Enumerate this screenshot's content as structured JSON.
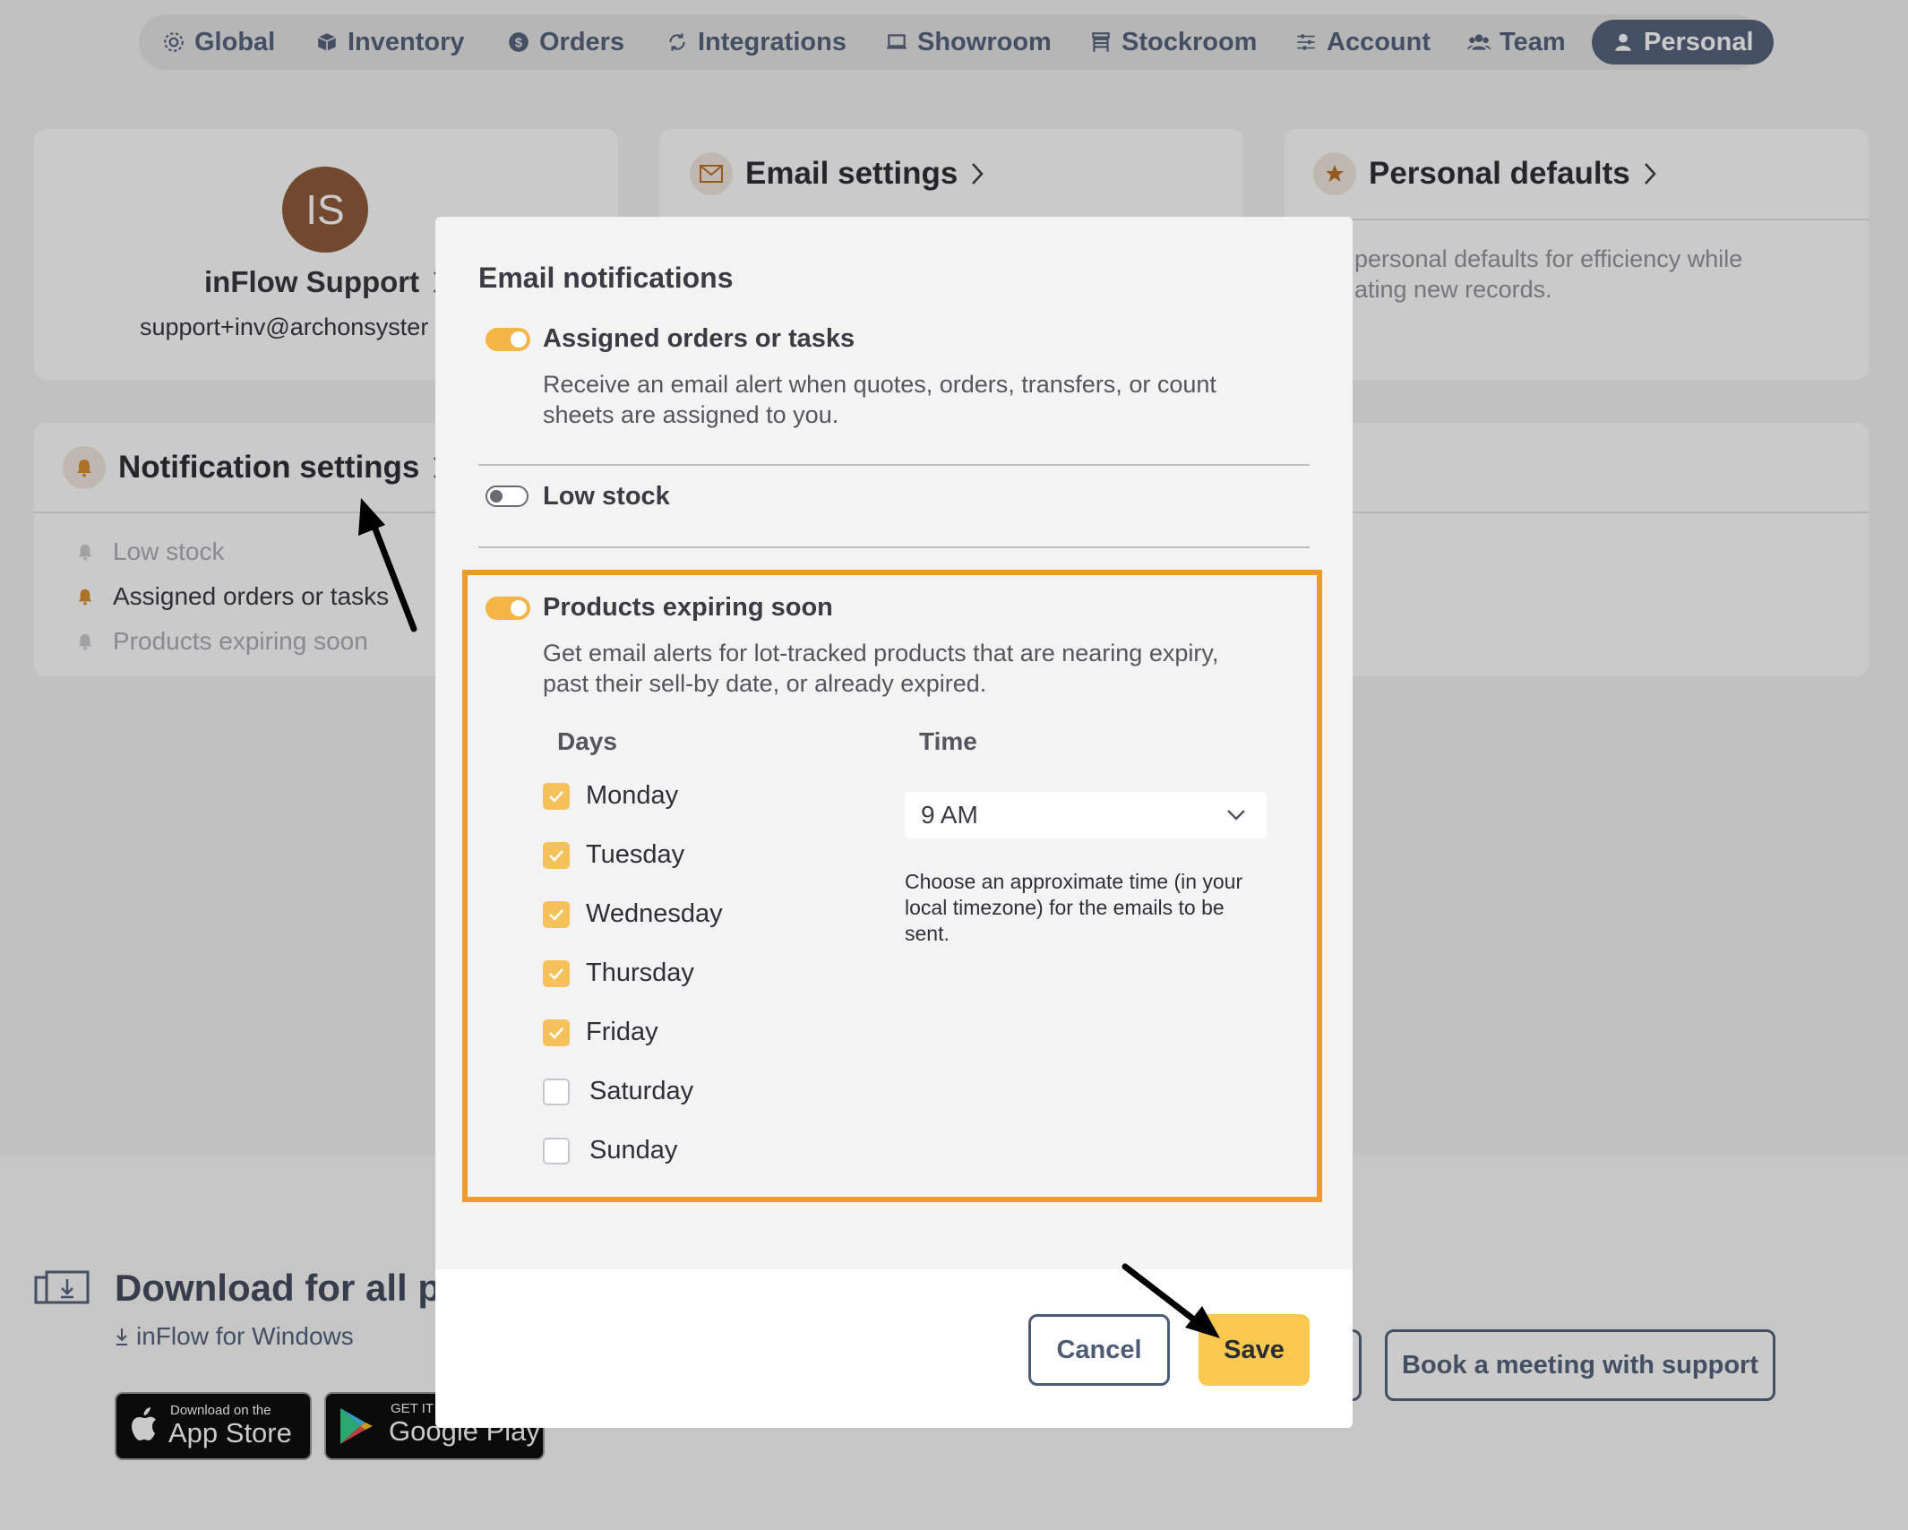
{
  "nav": {
    "items": [
      {
        "label": "Global",
        "icon": "gear-icon"
      },
      {
        "label": "Inventory",
        "icon": "box-icon"
      },
      {
        "label": "Orders",
        "icon": "dollar-icon"
      },
      {
        "label": "Integrations",
        "icon": "sync-icon"
      },
      {
        "label": "Showroom",
        "icon": "laptop-icon"
      },
      {
        "label": "Stockroom",
        "icon": "shelf-icon"
      },
      {
        "label": "Account",
        "icon": "sliders-icon"
      },
      {
        "label": "Team",
        "icon": "team-icon"
      },
      {
        "label": "Personal",
        "icon": "person-icon",
        "active": true
      }
    ]
  },
  "profile": {
    "initials": "IS",
    "name": "inFlow Support",
    "email": "support+inv@archonsyster"
  },
  "email_settings": {
    "title": "Email settings"
  },
  "personal_defaults": {
    "title": "Personal defaults",
    "desc_line1": "personal defaults for efficiency while",
    "desc_line2": "ating new records."
  },
  "notification_settings": {
    "title": "Notification settings",
    "items": [
      {
        "label": "Low stock",
        "active": false
      },
      {
        "label": "Assigned orders or tasks",
        "active": true
      },
      {
        "label": "Products expiring soon",
        "active": false
      }
    ]
  },
  "download": {
    "title": "Download for all pla",
    "windows_link": "inFlow for Windows",
    "app_store_small": "Download on the",
    "app_store_big": "App Store",
    "google_small": "GET IT O",
    "google_big": "Google Play"
  },
  "book_meeting": "Book a meeting with support",
  "modal": {
    "title": "Email notifications",
    "assigned": {
      "label": "Assigned orders or tasks",
      "enabled": true,
      "desc": "Receive an email alert when quotes, orders, transfers, or count sheets are assigned to you."
    },
    "low_stock": {
      "label": "Low stock",
      "enabled": false
    },
    "expiring": {
      "label": "Products expiring soon",
      "enabled": true,
      "desc": "Get email alerts for lot-tracked products that are nearing expiry, past their sell-by date, or already expired."
    },
    "days_header": "Days",
    "time_header": "Time",
    "days": [
      {
        "label": "Monday",
        "checked": true
      },
      {
        "label": "Tuesday",
        "checked": true
      },
      {
        "label": "Wednesday",
        "checked": true
      },
      {
        "label": "Thursday",
        "checked": true
      },
      {
        "label": "Friday",
        "checked": true
      },
      {
        "label": "Saturday",
        "checked": false
      },
      {
        "label": "Sunday",
        "checked": false
      }
    ],
    "time_value": "9 AM",
    "time_help": "Choose an approximate time (in your local timezone) for the emails to be sent.",
    "cancel": "Cancel",
    "save": "Save"
  },
  "colors": {
    "accent": "#f5b546",
    "highlight_border": "#ee9b2e",
    "nav_active": "#4e5b76",
    "save_bg": "#f9c84f"
  }
}
